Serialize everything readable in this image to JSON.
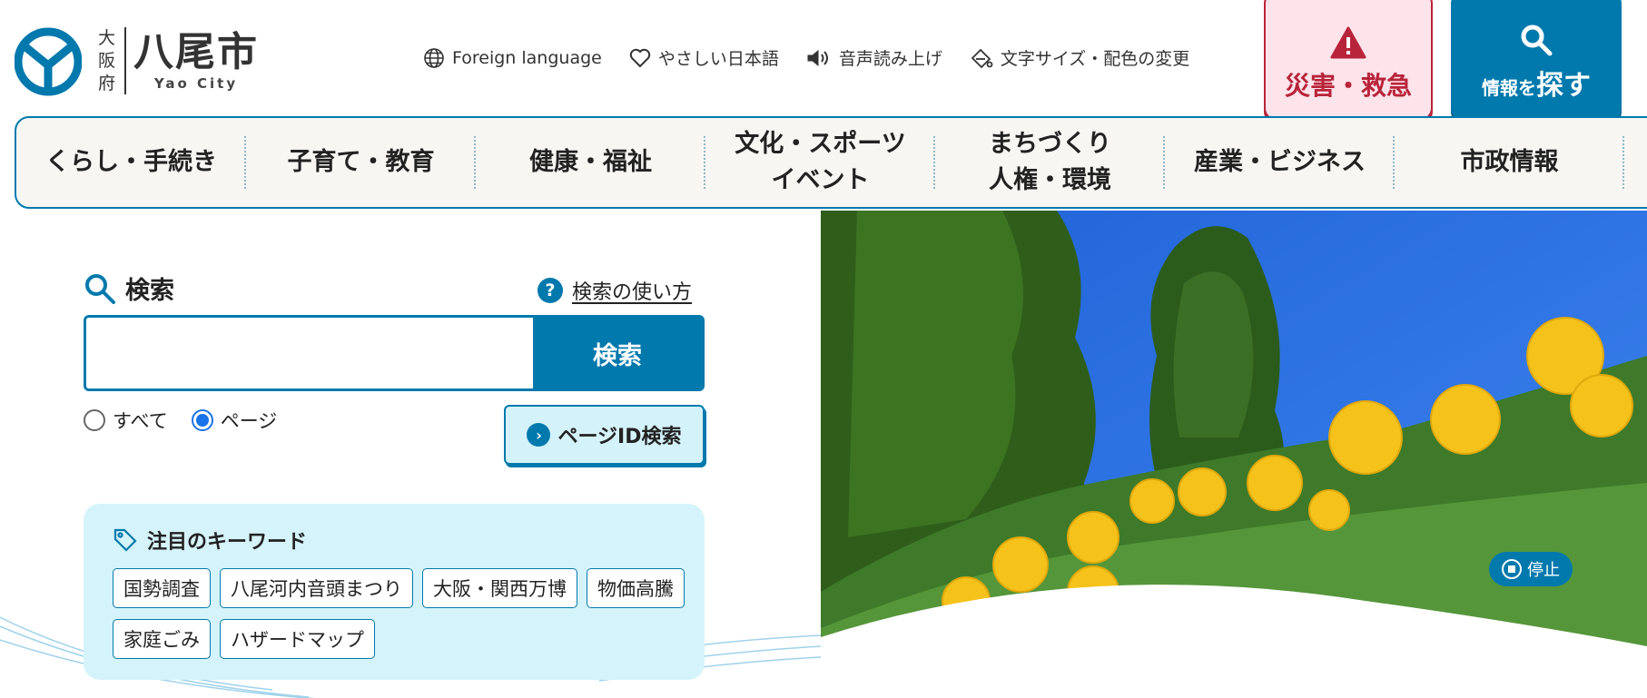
{
  "header": {
    "pref_chars": [
      "大",
      "阪",
      "府"
    ],
    "city_name": "八尾市",
    "city_name_en": "Yao City",
    "utilities": [
      {
        "label": "Foreign language",
        "icon": "globe-icon"
      },
      {
        "label": "やさしい日本語",
        "icon": "heart-icon"
      },
      {
        "label": "音声読み上げ",
        "icon": "speaker-icon"
      },
      {
        "label": "文字サイズ・配色の変更",
        "icon": "palette-icon"
      }
    ],
    "disaster_button": "災害・救急",
    "find_button_small_1": "情報",
    "find_button_small_2": "を",
    "find_button_big": "探す"
  },
  "nav": {
    "items": [
      "くらし・手続き",
      "子育て・教育",
      "健康・福祉",
      "文化・スポーツ\nイベント",
      "まちづくり\n人権・環境",
      "産業・ビジネス",
      "市政情報"
    ]
  },
  "search": {
    "title": "検索",
    "howto_label": "検索の使い方",
    "input_value": "",
    "input_placeholder": "",
    "button_label": "検索",
    "radio_all": "すべて",
    "radio_page": "ページ",
    "selected_radio": "ページ",
    "pageid_button": "ページID検索"
  },
  "keywords": {
    "title": "注目のキーワード",
    "items": [
      "国勢調査",
      "八尾河内音頭まつり",
      "大阪・関西万博",
      "物価高騰",
      "家庭ごみ",
      "ハザードマップ"
    ]
  },
  "hero": {
    "pause_label": "停止"
  },
  "colors": {
    "brand": "#0279ad",
    "disaster": "#b8243a",
    "disaster_bg": "#fde3ea",
    "keyword_panel_bg": "#d5f3fb"
  }
}
